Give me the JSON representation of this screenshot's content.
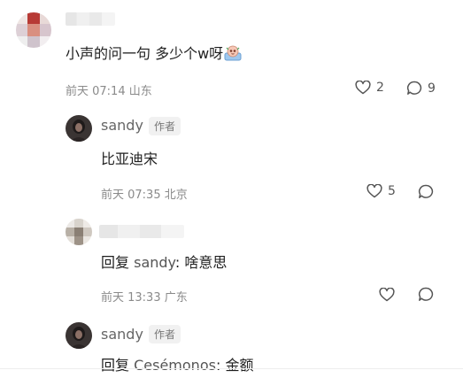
{
  "comment": {
    "text_before": "小声的问一句 多少个w呀",
    "emoji_icon": "pleading-emoji-icon",
    "date": "前天 07:14",
    "location": "山东",
    "likes": "2",
    "replies": "9"
  },
  "replies": [
    {
      "author": "sandy",
      "badge": "作者",
      "text": "比亚迪宋",
      "date": "前天 07:35",
      "location": "北京",
      "likes": "5"
    },
    {
      "reply_prefix": "回复",
      "reply_to": "sandy",
      "colon": ":",
      "text": "啥意思",
      "date": "前天 13:33",
      "location": "广东"
    },
    {
      "author": "sandy",
      "badge": "作者",
      "reply_prefix": "回复",
      "reply_to": "Cesémonos",
      "colon": ":",
      "text": "金额"
    }
  ],
  "colors": {
    "text": "#1f1f1f",
    "meta": "#8a8a8a",
    "badge_bg": "#f1f1f1"
  }
}
